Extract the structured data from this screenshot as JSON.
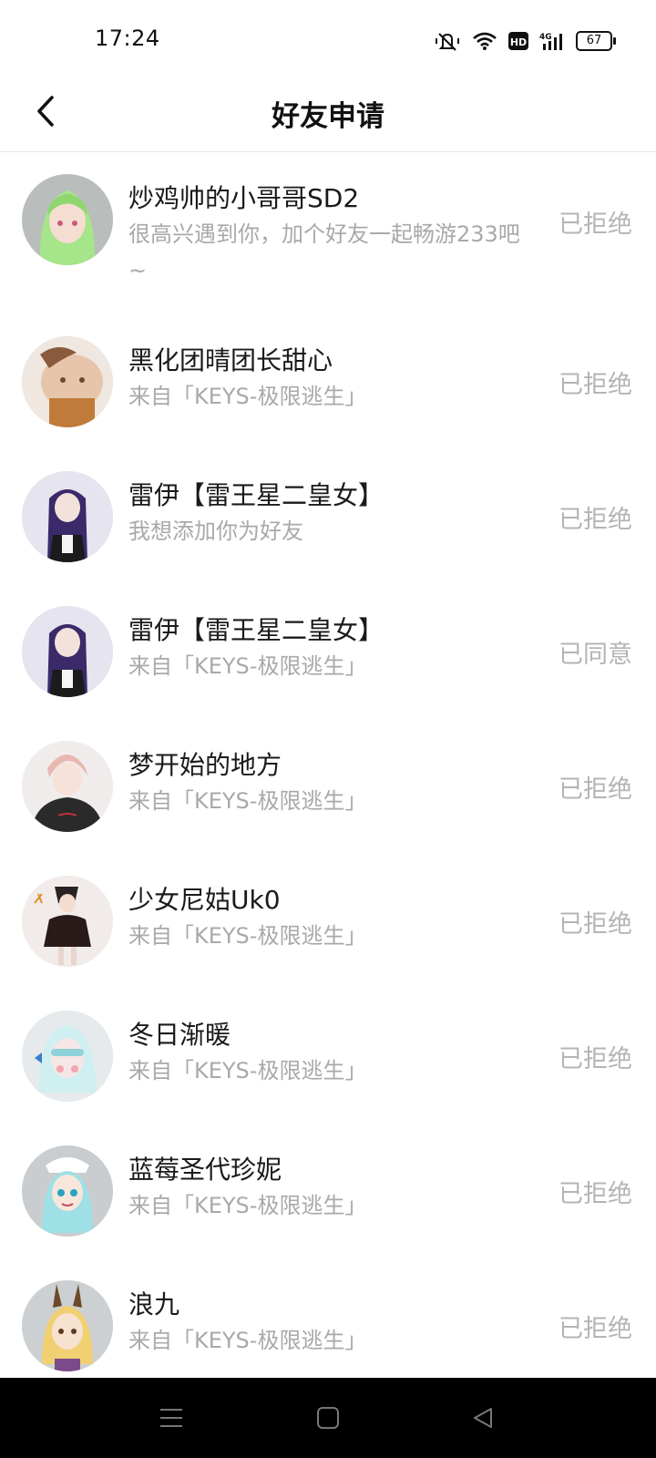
{
  "status_bar": {
    "time": "17:24",
    "battery": "67",
    "icons": [
      "vibrate-off-icon",
      "wifi-icon",
      "hd-icon",
      "signal-4g-icon",
      "battery-icon"
    ]
  },
  "header": {
    "title": "好友申请",
    "back_icon": "chevron-left-icon"
  },
  "requests": [
    {
      "name": "炒鸡帅的小哥哥SD2",
      "message": "很高兴遇到你，加个好友一起畅游233吧~",
      "status": "已拒绝"
    },
    {
      "name": "黑化团晴团长甜心",
      "message": "来自「KEYS-极限逃生」",
      "status": "已拒绝"
    },
    {
      "name": "雷伊【雷王星二皇女】",
      "message": "我想添加你为好友",
      "status": "已拒绝"
    },
    {
      "name": "雷伊【雷王星二皇女】",
      "message": "来自「KEYS-极限逃生」",
      "status": "已同意"
    },
    {
      "name": "梦开始的地方",
      "message": "来自「KEYS-极限逃生」",
      "status": "已拒绝"
    },
    {
      "name": "少女尼姑Uk0",
      "message": "来自「KEYS-极限逃生」",
      "status": "已拒绝"
    },
    {
      "name": "冬日渐暖",
      "message": "来自「KEYS-极限逃生」",
      "status": "已拒绝"
    },
    {
      "name": "蓝莓圣代珍妮",
      "message": "来自「KEYS-极限逃生」",
      "status": "已拒绝"
    },
    {
      "name": "浪九",
      "message": "来自「KEYS-极限逃生」",
      "status": "已拒绝"
    }
  ],
  "nav_bar": {
    "icons": [
      "menu-icon",
      "home-icon",
      "back-icon"
    ]
  },
  "colors": {
    "text_primary": "#1a1a1a",
    "text_secondary": "#a9a9a9",
    "status_text": "#b4b4b4",
    "nav_bg": "#000000"
  }
}
